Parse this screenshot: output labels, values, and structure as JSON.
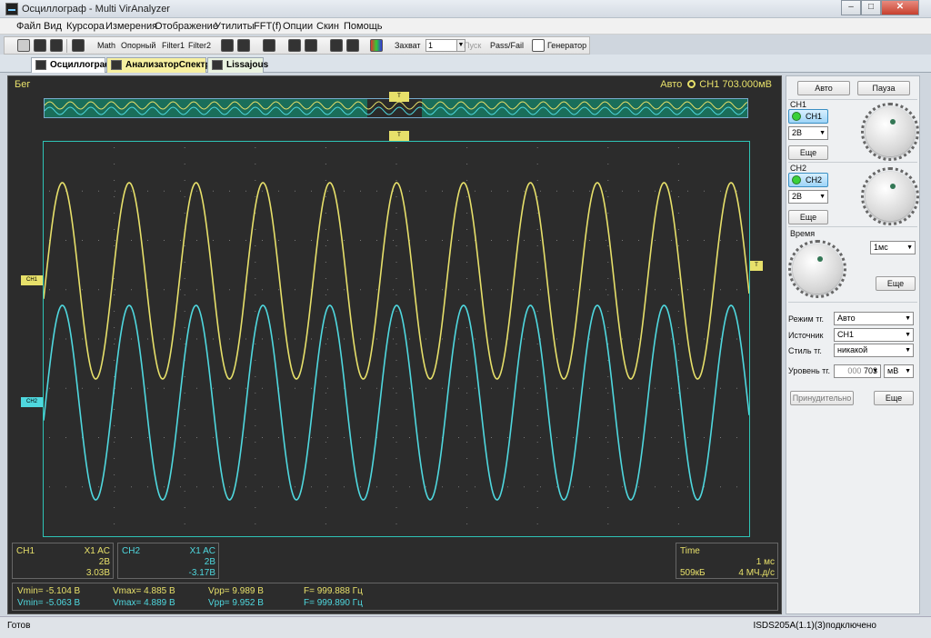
{
  "window": {
    "title": "Осциллограф - Multi VirAnalyzer",
    "min": "–",
    "max": "□",
    "close": "✕"
  },
  "menu": [
    "Файл",
    "Вид",
    "Курсора",
    "Измерения",
    "Отображение",
    "Утилиты",
    "FFT(f)",
    "Опции",
    "Скин",
    "Помощь"
  ],
  "toolbar": {
    "math": "Math",
    "ref": "Опорный",
    "filter1": "Filter1",
    "filter2": "Filter2",
    "capture_label": "Захват",
    "capture_value": "1",
    "start": "Пуск",
    "passfail": "Pass/Fail",
    "generator": "Генератор"
  },
  "tabs": [
    "Осциллограф",
    "АнализаторСпектра",
    "Lissajous"
  ],
  "scope": {
    "run_status": "Бег",
    "trigger_mode": "Авто",
    "trigger_info": "CH1 703.000мВ",
    "trig_marker": "T",
    "ch1_marker": "CH1",
    "ch2_marker": "CH2",
    "trig_level_marker": "T"
  },
  "ch1_box": {
    "name": "CH1",
    "coupling": "X1  AC",
    "volts": "2В",
    "offset": "3.03В"
  },
  "ch2_box": {
    "name": "CH2",
    "coupling": "X1  AC",
    "volts": "2В",
    "offset": "-3.17В"
  },
  "time_box": {
    "name": "Time",
    "timebase": "1 мс",
    "memory": "509кБ",
    "rate": "4 МЧ.д/с"
  },
  "measurements": [
    {
      "vmin": "Vmin= -5.104 В",
      "vmax": "Vmax= 4.885 В",
      "vpp": "Vpp= 9.989 В",
      "freq": "F= 999.888 Гц",
      "color": "#e7e06a"
    },
    {
      "vmin": "Vmin= -5.063 В",
      "vmax": "Vmax= 4.889 В",
      "vpp": "Vpp= 9.952 В",
      "freq": "F= 999.890 Гц",
      "color": "#4fd8df"
    }
  ],
  "colors": {
    "ch1": "#e7e06a",
    "ch2": "#4fd8df",
    "grid": "#2ec4b6"
  },
  "side": {
    "auto": "Авто",
    "pause": "Пауза",
    "ch1_label": "CH1",
    "ch1_btn": "CH1",
    "ch1_volts": "2В",
    "ch1_more": "Еще",
    "ch2_label": "CH2",
    "ch2_btn": "CH2",
    "ch2_volts": "2В",
    "ch2_more": "Еще",
    "time_label": "Время",
    "time_value": "1мс",
    "time_more": "Еще",
    "trig_mode_label": "Режим тг.",
    "trig_mode": "Авто",
    "source_label": "Источник",
    "source": "CH1",
    "style_label": "Стиль тг.",
    "style": "никакой",
    "level_label": "Уровень тг.",
    "level_prefix": "000",
    "level_value": "703",
    "level_unit": "мВ",
    "force": "Принудительно",
    "more": "Еще"
  },
  "status": {
    "left": "Готов",
    "right": "ISDS205A(1.1)(3)подключено"
  }
}
